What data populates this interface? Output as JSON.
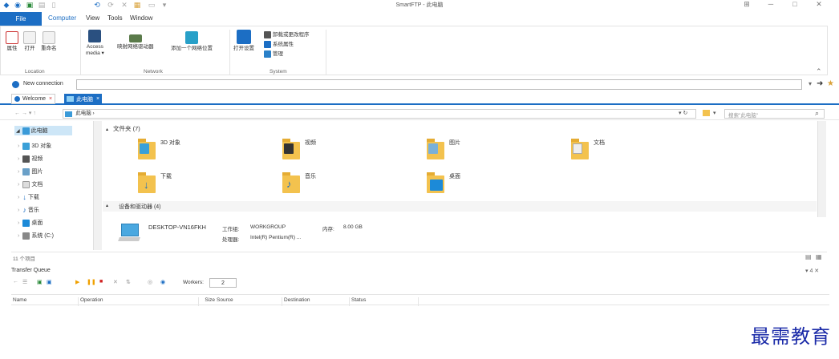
{
  "window": {
    "title": "SmartFTP - 此电脑",
    "min": "─",
    "max": "□",
    "close": "✕",
    "restore": "⊞"
  },
  "quick_access": [
    "⟲",
    "⟳",
    "✕"
  ],
  "menu": {
    "file": "File",
    "tabs": [
      "Computer",
      "View",
      "Tools",
      "Window"
    ]
  },
  "ribbon": {
    "location": {
      "label": "Location",
      "buttons": [
        "属性",
        "打开",
        "重命名"
      ]
    },
    "network": {
      "label": "Network",
      "access_media_1": "Access",
      "access_media_2": "media ▾",
      "map_drive": "映射网络驱动器",
      "add_location": "添加一个网络位置"
    },
    "system": {
      "label": "System",
      "open_settings": "打开设置",
      "uninstall": "卸载或更改程序",
      "sys_props": "系统属性",
      "manage": "管理"
    }
  },
  "connection": {
    "label": "New connection",
    "value": ""
  },
  "tabs": [
    {
      "label": "Welcome",
      "close": "×"
    },
    {
      "label": "此电脑",
      "close": "×"
    }
  ],
  "address": {
    "nav": "← → ▾ ↑",
    "path": "此电脑 ›",
    "search_placeholder": "搜索\"此电脑\"",
    "refresh": "▾ ↻"
  },
  "tree": {
    "items": [
      "此电脑",
      "3D 对象",
      "视频",
      "图片",
      "文档",
      "下载",
      "音乐",
      "桌面",
      "系统 (C:)"
    ]
  },
  "main": {
    "folders_header": "文件夹 (7)",
    "folders": [
      "3D 对象",
      "视频",
      "图片",
      "文档",
      "下载",
      "音乐",
      "桌面"
    ],
    "devices_header": "设备和驱动器 (4)",
    "computer": {
      "name": "DESKTOP-VN16FKH",
      "workgroup_label": "工作组:",
      "workgroup": "WORKGROUP",
      "memory_label": "内存:",
      "memory": "8.00 GB",
      "cpu_label": "处理器:",
      "cpu": "Intel(R) Pentium(R) ..."
    }
  },
  "status": {
    "items": "11 个项目"
  },
  "transfer_queue": {
    "title": "Transfer Queue",
    "pin": "▾ 4 ✕",
    "workers_label": "Workers:",
    "workers": "2",
    "columns": [
      "Name",
      "Operation",
      "Size",
      "Source",
      "Destination",
      "Status"
    ]
  },
  "watermark": "最需教育"
}
